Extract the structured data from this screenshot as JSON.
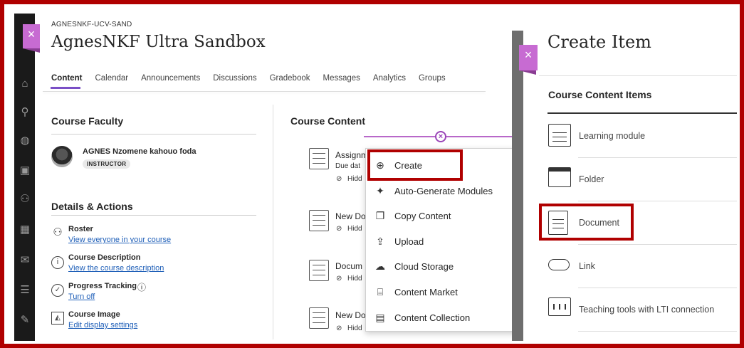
{
  "course": {
    "org_code": "AGNESNKF-UCV-SAND",
    "title": "AgnesNKF Ultra Sandbox"
  },
  "tabs": [
    {
      "label": "Content",
      "active": true
    },
    {
      "label": "Calendar"
    },
    {
      "label": "Announcements"
    },
    {
      "label": "Discussions"
    },
    {
      "label": "Gradebook"
    },
    {
      "label": "Messages"
    },
    {
      "label": "Analytics"
    },
    {
      "label": "Groups"
    }
  ],
  "faculty": {
    "heading": "Course Faculty",
    "name": "AGNES Nzomene kahouo foda",
    "role": "INSTRUCTOR"
  },
  "details": {
    "heading": "Details & Actions",
    "items": [
      {
        "title": "Roster",
        "link": "View everyone in your course",
        "icon": "roster-icon"
      },
      {
        "title": "Course Description",
        "link": "View the course description",
        "icon": "info-icon"
      },
      {
        "title": "Progress Tracking",
        "link": "Turn off",
        "icon": "check-circle-icon"
      },
      {
        "title": "Course Image",
        "link": "Edit display settings",
        "icon": "image-icon"
      }
    ]
  },
  "content": {
    "heading": "Course Content",
    "items": [
      {
        "title": "Assignm",
        "sub1": "Due dat",
        "sub2": "Hidd"
      },
      {
        "title": "New Do",
        "sub2": "Hidd"
      },
      {
        "title": "Docum",
        "sub2": "Hidd"
      },
      {
        "title": "New Do",
        "sub2": "Hidd"
      }
    ]
  },
  "menu": {
    "items": [
      {
        "label": "Create",
        "icon": "plus-circle-icon"
      },
      {
        "label": "Auto-Generate Modules",
        "icon": "sparkle-icon"
      },
      {
        "label": "Copy Content",
        "icon": "copy-icon"
      },
      {
        "label": "Upload",
        "icon": "upload-icon"
      },
      {
        "label": "Cloud Storage",
        "icon": "cloud-icon"
      },
      {
        "label": "Content Market",
        "icon": "market-icon"
      },
      {
        "label": "Content Collection",
        "icon": "collection-icon"
      }
    ]
  },
  "create_panel": {
    "title": "Create Item",
    "section": "Course Content Items",
    "items": [
      {
        "label": "Learning module",
        "icon": "learning-module-icon"
      },
      {
        "label": "Folder",
        "icon": "folder-icon"
      },
      {
        "label": "Document",
        "icon": "document-icon"
      },
      {
        "label": "Link",
        "icon": "link-icon"
      },
      {
        "label": "Teaching tools with LTI connection",
        "icon": "lti-tools-icon"
      }
    ]
  },
  "glyphs": {
    "close": "×",
    "plus": "+",
    "info_circle": "ⓘ"
  },
  "colors": {
    "highlight": "#b00000",
    "accent_purple": "#c76bd2",
    "link": "#1f5fb8"
  }
}
